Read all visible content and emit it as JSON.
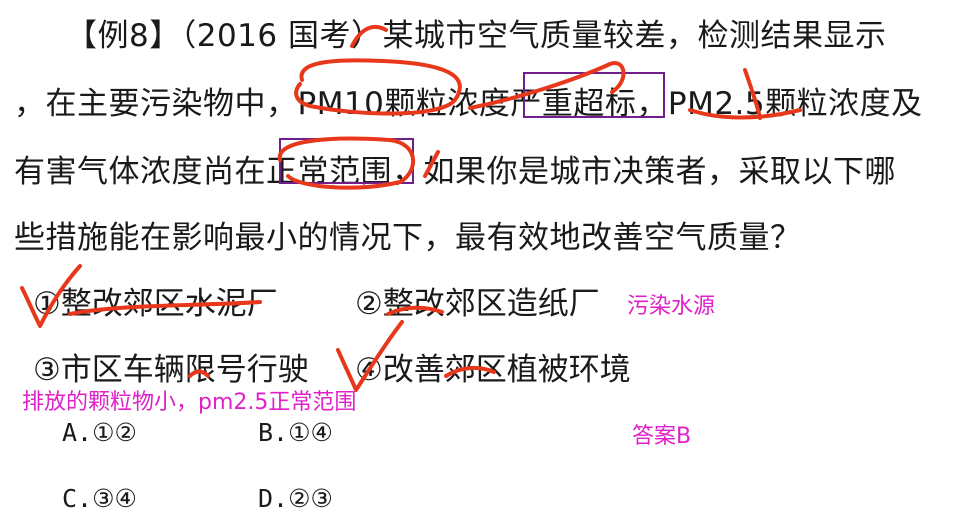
{
  "question": {
    "line1": "【例8】（2016 国考）某城市空气质量较差，检测结果显示",
    "line2": "，在主要污染物中，PM10颗粒浓度严重超标，PM2.5颗粒浓度及",
    "line3": "有害气体浓度尚在正常范围，如果你是城市决策者，采取以下哪",
    "line4": "些措施能在影响最小的情况下，最有效地改善空气质量？"
  },
  "options": {
    "o1": "①整改郊区水泥厂",
    "o2": "②整改郊区造纸厂",
    "o3": "③市区车辆限号行驶",
    "o4": "④改善郊区植被环境"
  },
  "answers": {
    "a": "A.①②",
    "b": "B.①④",
    "c": "C.③④",
    "d": "D.②③"
  },
  "notes": {
    "water_source": "污染水源",
    "particles": "排放的颗粒物小，pm2.5正常范围",
    "answer": "答案B"
  },
  "colors": {
    "annotation_pink": "#e020c8",
    "ink_red": "#e8381c",
    "box_purple": "#6f1e8c"
  }
}
